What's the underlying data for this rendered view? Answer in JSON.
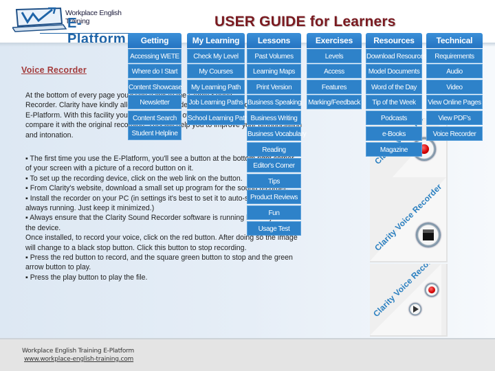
{
  "header": {
    "logo_subtitle": "Workplace English Training",
    "logo_title": "E-Platform",
    "guide_title": "USER GUIDE for Learners"
  },
  "menu": {
    "columns": [
      {
        "label": "Getting Started",
        "items": [
          "Accessing WETE",
          "Where do I Start",
          "Content Showcase",
          "Newsletter",
          "Content Search",
          "Student Helpline"
        ]
      },
      {
        "label": "My Learning",
        "items": [
          "Check My Level",
          "My Courses",
          "My Learning Path",
          "Job Learning Paths",
          "School Learning Path"
        ]
      },
      {
        "label": "Lessons",
        "items": [
          "Past Volumes",
          "Learning Maps",
          "Print Version",
          "Business Speaking",
          "Business Writing",
          "Business Vocabulary",
          "Reading",
          "Editor's Corner",
          "Tips",
          "Product Reviews",
          "Fun",
          "Usage Test"
        ]
      },
      {
        "label": "Exercises",
        "items": [
          "Levels",
          "Access",
          "Features",
          "Marking/Feedback"
        ]
      },
      {
        "label": "Resources",
        "items": [
          "Download Resources",
          "Model Documents",
          "Word of the Day",
          "Tip of the Week",
          "Podcasts",
          "e-Books",
          "Magazine"
        ]
      },
      {
        "label": "Technical",
        "items": [
          "Requirements",
          "Audio",
          "Video",
          "View Online Pages",
          "View PDF's",
          "Voice Recorder"
        ]
      }
    ]
  },
  "article": {
    "title": "Voice Recorder",
    "intro_lines": [
      "At the bottom of every page you'll see a link to the Clarity Sound",
      "Recorder. Clarity have kindly allowed us to include their sound recorder into the",
      "E-Platform. With this facility you can record your own voice and",
      "compare it with the original recording. This will help you to improve your pronunciation",
      "and intonation."
    ],
    "steps_lines": [
      "▪ The first time you use the E-Platform, you'll see a button at the bottom right corner",
      "of your screen with a picture of a record button on it.",
      "▪ To set up the recording device, click on the web link on the button.",
      "▪ From Clarity's website, download a small set up program for the sound recorder.",
      "▪ Install the recorder on your PC (in settings it's best to set it to auto-start so that it is",
      "always running. Just keep it minimized.)",
      "▪ Always ensure that the Clarity Sound Recorder software is running before you use",
      "the device.",
      "  Once installed, to record your voice, click on the red button. After doing so the image",
      "will change to a black stop button. Click this button to stop recording.",
      "▪ Press the red button to record, and the square green button to stop and the green",
      "arrow button to play.",
      "▪ Press the play button to play the file."
    ]
  },
  "recorder_panels": [
    {
      "label": "Clarity Voice Recorder",
      "state": "record"
    },
    {
      "label": "Clarity Voice Recorder",
      "state": "stop"
    },
    {
      "label": "Clarity Voice Recorder",
      "state": "record-play"
    }
  ],
  "footer": {
    "line1": "Workplace English Training E-Platform",
    "link": "www.workplace-english-training.com"
  },
  "colors": {
    "menu_blue": "#2e82c9",
    "title_maroon": "#7a1a20",
    "section_title": "#a33a3a",
    "recorder_label": "#2a7fc0"
  }
}
